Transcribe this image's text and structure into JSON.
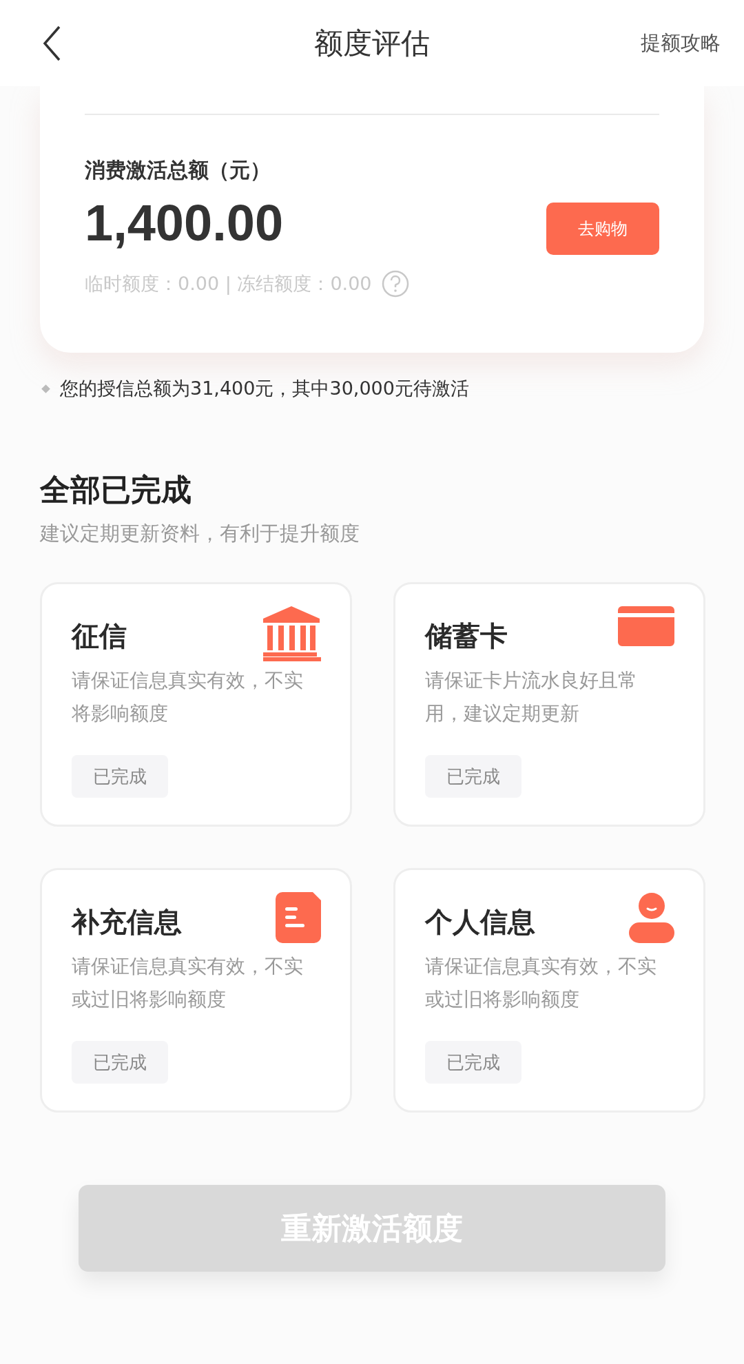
{
  "header": {
    "title": "额度评估",
    "action": "提额攻略"
  },
  "summary": {
    "label": "消费激活总额（元）",
    "amount": "1,400.00",
    "button": "去购物",
    "detail": "临时额度：0.00 | 冻结额度：0.00"
  },
  "note": "您的授信总额为31,400元，其中30,000元待激活",
  "section": {
    "title": "全部已完成",
    "subtitle": "建议定期更新资料，有利于提升额度"
  },
  "cards": [
    {
      "kind": "bank",
      "title": "征信",
      "description": "请保证信息真实有效，不实将影响额度",
      "status": "已完成"
    },
    {
      "kind": "card",
      "title": "储蓄卡",
      "description": "请保证卡片流水良好且常用，建议定期更新",
      "status": "已完成"
    },
    {
      "kind": "document",
      "title": "补充信息",
      "description": "请保证信息真实有效，不实或过旧将影响额度",
      "status": "已完成"
    },
    {
      "kind": "person",
      "title": "个人信息",
      "description": "请保证信息真实有效，不实或过旧将影响额度",
      "status": "已完成"
    }
  ],
  "bottom_button": {
    "label": "重新激活额度",
    "disabled": true
  }
}
